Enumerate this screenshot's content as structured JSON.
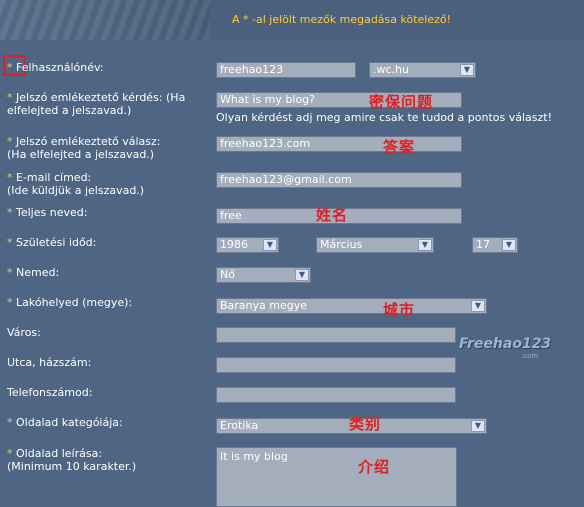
{
  "banner": {
    "required_note": "A * -al jelölt mezők megadása kötelező!"
  },
  "required_marker": "*",
  "fields": {
    "username": {
      "label": "Felhasználónév:",
      "value": "freehao123",
      "domain": ".wc.hu"
    },
    "secret_question": {
      "label_line1": "Jelszó emlékeztető kérdés: (Ha",
      "label_line2": "elfelejted a jelszavad.)",
      "value": "What is my blog?",
      "hint": "Olyan kérdést adj meg amire csak te tudod a pontos választ!"
    },
    "secret_answer": {
      "label_line1": "Jelszó emlékeztető válasz:",
      "label_line2": "(Ha elfelejted a jelszavad.)",
      "value": "freehao123.com"
    },
    "email": {
      "label_line1": "E-mail címed:",
      "label_line2": "(Ide küldjük a jelszavad.)",
      "value": "freehao123@gmail.com"
    },
    "full_name": {
      "label": "Teljes neved:",
      "value": "free"
    },
    "birthdate": {
      "label": "Születési időd:",
      "year": "1986",
      "month": "Március",
      "day": "17"
    },
    "gender": {
      "label": "Nemed:",
      "value": "Nő"
    },
    "county": {
      "label": "Lakóhelyed (megye):",
      "value": "Baranya megye"
    },
    "city": {
      "label": "Város:",
      "value": ""
    },
    "street": {
      "label": "Utca, házszám:",
      "value": ""
    },
    "phone": {
      "label": "Telefonszámod:",
      "value": ""
    },
    "category": {
      "label": "Oldalad kategóiája:",
      "value": "Erotika"
    },
    "description": {
      "label_line1": "Oldalad leírása:",
      "label_line2": "(Minimum 10 karakter.)",
      "value": "It is my blog"
    }
  },
  "annotations": {
    "question": "密保问题",
    "answer": "答案",
    "name": "姓名",
    "city": "城市",
    "category": "类别",
    "intro": "介绍"
  },
  "watermark": {
    "text": "Freehao123",
    "sub": ".com"
  },
  "colors": {
    "background": "#4e6584",
    "required_star": "#ffcc33",
    "annotation": "#e02020",
    "field_bg": "#a3adbc"
  },
  "icons": {
    "dropdown": "chevron-down-icon"
  }
}
